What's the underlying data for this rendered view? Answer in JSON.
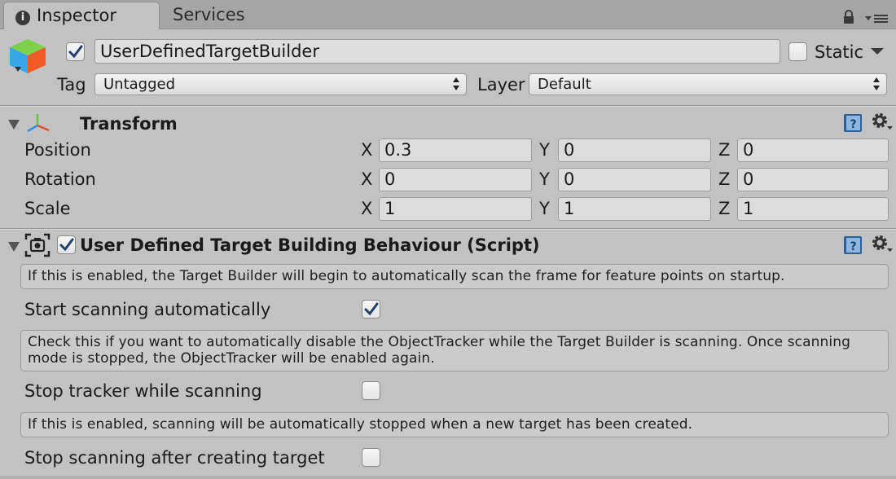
{
  "tabs": [
    {
      "label": "Inspector",
      "icon": "info-icon",
      "active": true
    },
    {
      "label": "Services",
      "active": false
    }
  ],
  "object": {
    "active": true,
    "name": "UserDefinedTargetBuilder",
    "static_label": "Static",
    "static_checked": false,
    "tag_label": "Tag",
    "tag_value": "Untagged",
    "layer_label": "Layer",
    "layer_value": "Default"
  },
  "transform": {
    "title": "Transform",
    "rows": [
      {
        "label": "Position",
        "x": "0.3",
        "y": "0",
        "z": "0"
      },
      {
        "label": "Rotation",
        "x": "0",
        "y": "0",
        "z": "0"
      },
      {
        "label": "Scale",
        "x": "1",
        "y": "1",
        "z": "1"
      }
    ],
    "axis_labels": {
      "x": "X",
      "y": "Y",
      "z": "Z"
    }
  },
  "script_component": {
    "title": "User Defined Target Building Behaviour (Script)",
    "enabled": true,
    "fields": [
      {
        "help": "If this is enabled, the Target Builder will begin to automatically scan the frame for feature points on startup.",
        "label": "Start scanning automatically",
        "checked": true
      },
      {
        "help": "Check this if you want to automatically disable the ObjectTracker while the Target Builder is scanning. Once scanning mode is stopped, the ObjectTracker will be enabled again.",
        "label": "Stop tracker while scanning",
        "checked": false
      },
      {
        "help": "If this is enabled, scanning will be automatically stopped when a new target has been created.",
        "label": "Stop scanning after creating target",
        "checked": false
      }
    ]
  },
  "colors": {
    "background": "#c2c2c2",
    "tabbar": "#a5a5a5",
    "checkmark": "#1f3f6e",
    "help_blue": "#3a6ea8"
  }
}
